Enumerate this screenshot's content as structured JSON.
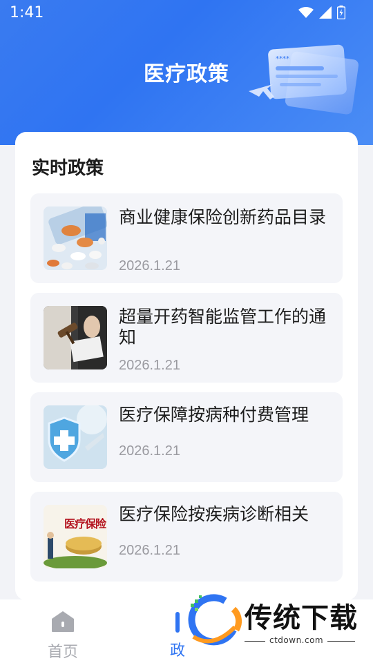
{
  "status_bar": {
    "time": "1:41"
  },
  "header": {
    "title": "医疗政策"
  },
  "section": {
    "title": "实时政策"
  },
  "policies": [
    {
      "title": "商业健康保险创新药品目录",
      "date": "2026.1.21",
      "thumb_icon": "pills-image"
    },
    {
      "title": "超量开药智能监管工作的通知",
      "date": "2026.1.21",
      "thumb_icon": "gavel-image"
    },
    {
      "title": "医疗保障按病种付费管理",
      "date": "2026.1.21",
      "thumb_icon": "medical-shield-image"
    },
    {
      "title": "医疗保险按疾病诊断相关",
      "date": "2026.1.21",
      "thumb_icon": "insurance-image",
      "thumb_text": "医疗保险"
    }
  ],
  "tabbar": {
    "home_label": "首页",
    "policy_label": "政"
  },
  "watermark": {
    "text": "传统下载",
    "url": "ctdown.com"
  },
  "colors": {
    "primary": "#2f74f2",
    "card_bg": "#f4f5f9",
    "muted": "#9a9aa0"
  }
}
